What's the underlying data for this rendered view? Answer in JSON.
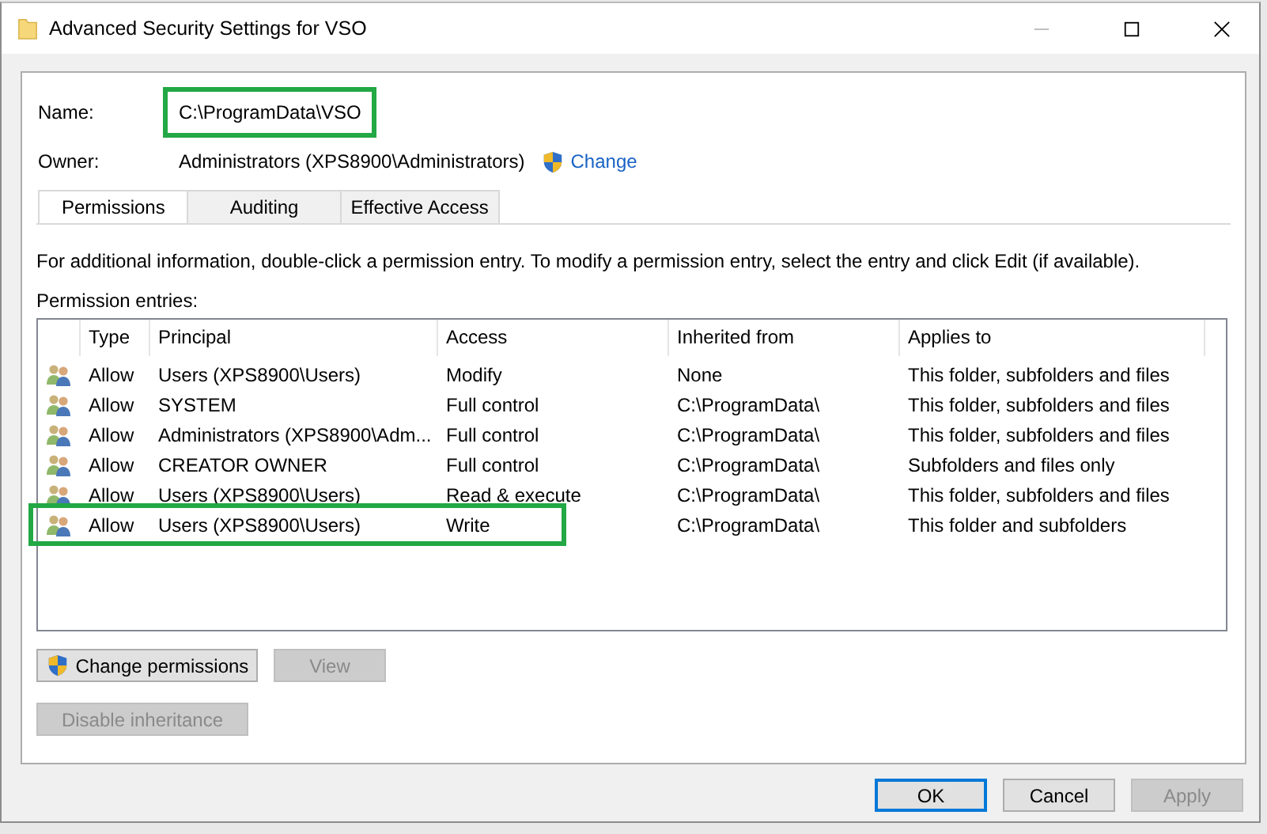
{
  "window": {
    "title": "Advanced Security Settings for VSO"
  },
  "name": {
    "label": "Name:",
    "value": "C:\\ProgramData\\VSO",
    "highlighted": true
  },
  "owner": {
    "label": "Owner:",
    "value": "Administrators (XPS8900\\Administrators)",
    "change_link": "Change"
  },
  "tabs": [
    {
      "label": "Permissions",
      "selected": true
    },
    {
      "label": "Auditing",
      "selected": false
    },
    {
      "label": "Effective Access",
      "selected": false
    }
  ],
  "info_text": "For additional information, double-click a permission entry. To modify a permission entry, select the entry and click Edit (if available).",
  "entries_label": "Permission entries:",
  "table": {
    "columns": [
      "Type",
      "Principal",
      "Access",
      "Inherited from",
      "Applies to"
    ],
    "rows": [
      {
        "type": "Allow",
        "principal": "Users (XPS8900\\Users)",
        "access": "Modify",
        "inherited_from": "None",
        "applies_to": "This folder, subfolders and files",
        "highlighted": false
      },
      {
        "type": "Allow",
        "principal": "SYSTEM",
        "access": "Full control",
        "inherited_from": "C:\\ProgramData\\",
        "applies_to": "This folder, subfolders and files",
        "highlighted": false
      },
      {
        "type": "Allow",
        "principal": "Administrators (XPS8900\\Adm...",
        "access": "Full control",
        "inherited_from": "C:\\ProgramData\\",
        "applies_to": "This folder, subfolders and files",
        "highlighted": false
      },
      {
        "type": "Allow",
        "principal": "CREATOR OWNER",
        "access": "Full control",
        "inherited_from": "C:\\ProgramData\\",
        "applies_to": "Subfolders and files only",
        "highlighted": false
      },
      {
        "type": "Allow",
        "principal": "Users (XPS8900\\Users)",
        "access": "Read & execute",
        "inherited_from": "C:\\ProgramData\\",
        "applies_to": "This folder, subfolders and files",
        "highlighted": false
      },
      {
        "type": "Allow",
        "principal": "Users (XPS8900\\Users)",
        "access": "Write",
        "inherited_from": "C:\\ProgramData\\",
        "applies_to": "This folder and subfolders",
        "highlighted": true
      }
    ]
  },
  "actions": [
    {
      "label": "Change permissions",
      "shield": true,
      "disabled": false
    },
    {
      "label": "View",
      "shield": false,
      "disabled": true
    }
  ],
  "inheritance_button": {
    "label": "Disable inheritance",
    "disabled": true
  },
  "footer_buttons": [
    {
      "label": "OK",
      "default": true,
      "disabled": false
    },
    {
      "label": "Cancel",
      "default": false,
      "disabled": false
    },
    {
      "label": "Apply",
      "default": false,
      "disabled": true
    }
  ]
}
